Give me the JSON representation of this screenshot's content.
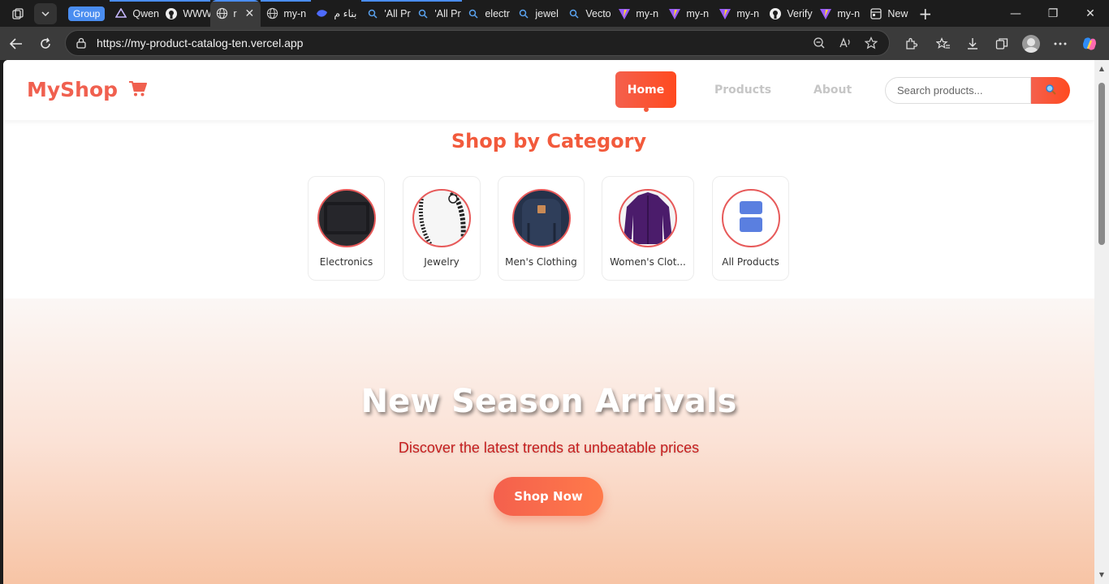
{
  "browser": {
    "group_label": "Group",
    "tabs": [
      {
        "label": "Qwen",
        "icon": "qwen-icon"
      },
      {
        "label": "WWW",
        "icon": "github-icon"
      },
      {
        "label": "r",
        "icon": "globe-icon",
        "active": true
      },
      {
        "label": "my-n",
        "icon": "globe-icon"
      },
      {
        "label": "بناء م",
        "icon": "deepseek-icon"
      },
      {
        "label": "'All Pr",
        "icon": "search-icon"
      },
      {
        "label": "'All Pr",
        "icon": "search-icon"
      },
      {
        "label": "electr",
        "icon": "search-icon"
      },
      {
        "label": "jewel",
        "icon": "search-icon"
      },
      {
        "label": "Vecto",
        "icon": "search-icon"
      },
      {
        "label": "my-n",
        "icon": "vite-icon"
      },
      {
        "label": "my-n",
        "icon": "vite-icon"
      },
      {
        "label": "my-n",
        "icon": "vite-icon"
      },
      {
        "label": "Verify",
        "icon": "github-icon"
      },
      {
        "label": "my-n",
        "icon": "vite-icon"
      },
      {
        "label": "New",
        "icon": "newtab-icon"
      }
    ],
    "url": "https://my-product-catalog-ten.vercel.app"
  },
  "site": {
    "logo": "MyShop",
    "nav": {
      "home": "Home",
      "products": "Products",
      "about": "About"
    },
    "search_placeholder": "Search products..."
  },
  "categories": {
    "title": "Shop by Category",
    "items": [
      {
        "label": "Electronics"
      },
      {
        "label": "Jewelry"
      },
      {
        "label": "Men's Clothing"
      },
      {
        "label": "Women's Clot..."
      },
      {
        "label": "All Products"
      }
    ]
  },
  "hero": {
    "title": "New Season Arrivals",
    "subtitle": "Discover the latest trends at unbeatable prices",
    "cta": "Shop Now"
  },
  "colors": {
    "accent": "#f25a3c",
    "brand": "#f0604f",
    "subtitle": "#c61e1e"
  }
}
